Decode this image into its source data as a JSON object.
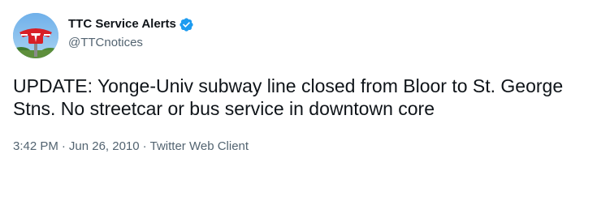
{
  "account": {
    "display_name": "TTC Service Alerts",
    "handle": "@TTCnotices",
    "verified": true,
    "avatar_icon": "ttc-logo-avatar"
  },
  "tweet": {
    "text": "UPDATE: Yonge-Univ subway line closed from Bloor to St. George Stns. No streetcar or bus service in downtown core"
  },
  "meta": {
    "time": "3:42 PM",
    "separator": "·",
    "date": "Jun 26, 2010",
    "client": "Twitter Web Client"
  },
  "colors": {
    "verified_blue": "#1d9bf0",
    "secondary_text": "#536471",
    "ttc_red": "#d81f26"
  }
}
